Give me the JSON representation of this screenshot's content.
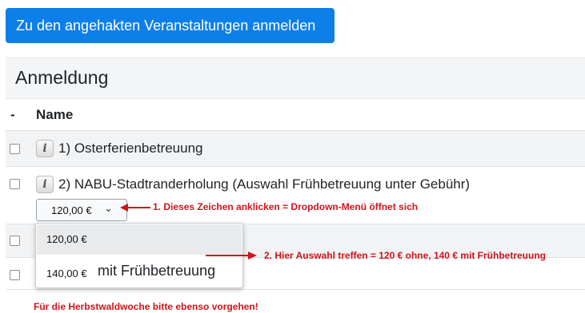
{
  "toolbar": {
    "register_checked_label": "Zu den angehakten Veranstaltungen anmelden"
  },
  "section": {
    "title": "Anmeldung"
  },
  "table": {
    "headers": {
      "select": "-",
      "name": "Name"
    },
    "rows": [
      {
        "label": "1) Osterferienbetreuung"
      },
      {
        "label": "2) NABU-Stadtranderholung (Auswahl Frühbetreuung unter Gebühr)",
        "price_selected": "120,00 €"
      }
    ]
  },
  "dropdown": {
    "options": [
      {
        "price": "120,00 €",
        "extra": ""
      },
      {
        "price": "140,00 €",
        "extra": "mit Frühbetreuung"
      }
    ]
  },
  "annotations": {
    "step1": "1. Dieses Zeichen anklicken = Dropdown-Menü öffnet sich",
    "step2": "2. Hier Auswahl treffen = 120 € ohne, 140 € mit Frühbetreuung",
    "footer": "Für die Herbstwaldwoche bitte ebenso vorgehen!"
  },
  "icons": {
    "info": "info-icon",
    "chevron": "chevron-down-icon",
    "arrow": "arrow-left-icon"
  },
  "colors": {
    "primary": "#0d7fe8",
    "annotation": "#d0141b"
  }
}
